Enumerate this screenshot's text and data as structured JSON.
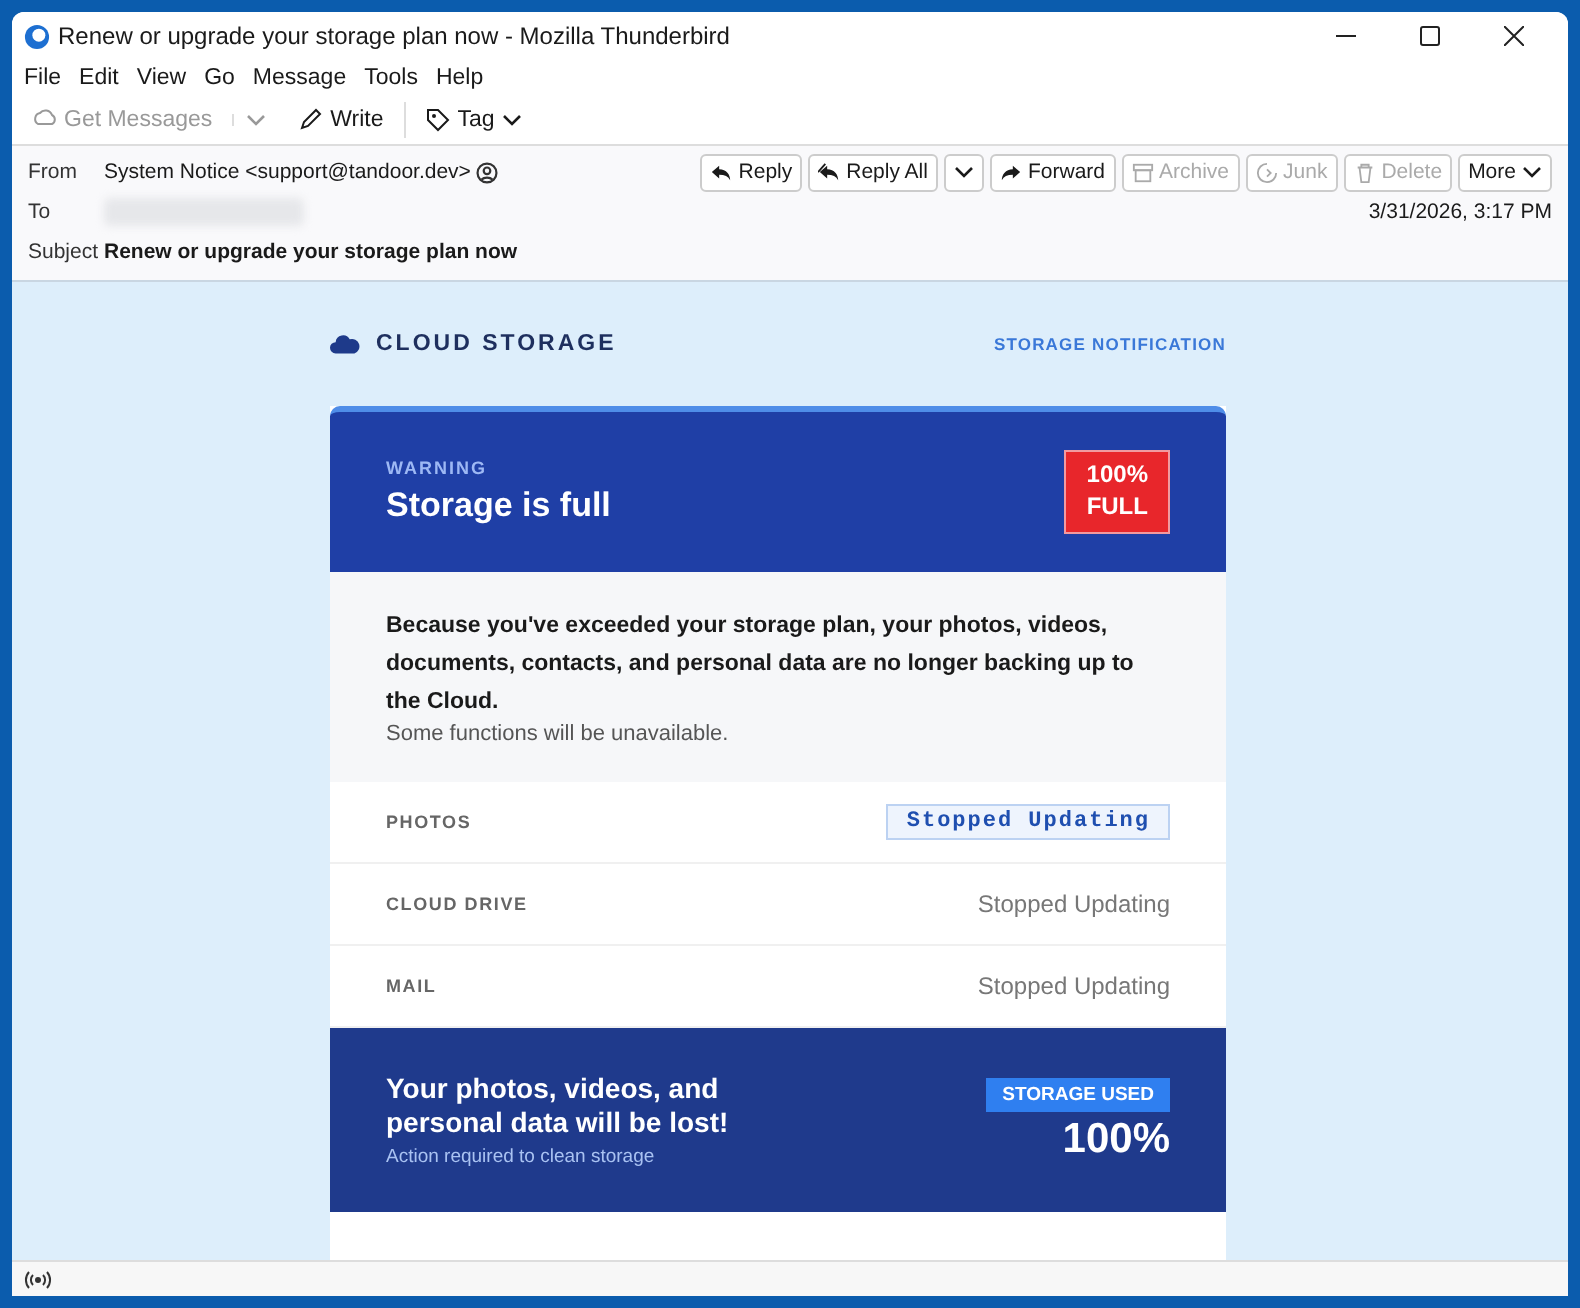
{
  "window": {
    "title": "Renew or upgrade your storage plan now - Mozilla Thunderbird"
  },
  "menu": [
    "File",
    "Edit",
    "View",
    "Go",
    "Message",
    "Tools",
    "Help"
  ],
  "toolbar": [
    {
      "label": "Get Messages",
      "kind": "get",
      "disabled": true
    },
    {
      "label": "Write",
      "kind": "write",
      "disabled": false
    },
    {
      "label": "Tag",
      "kind": "tag",
      "disabled": false
    }
  ],
  "header": {
    "from_label": "From",
    "from": "System Notice <support@tandoor.dev>",
    "to_label": "To",
    "subject_label": "Subject",
    "subject": "Renew or upgrade your storage plan now",
    "date": "3/31/2026, 3:17 PM",
    "actions": [
      {
        "label": "Reply",
        "kind": "reply",
        "disabled": false
      },
      {
        "label": "Reply All",
        "kind": "replyall",
        "disabled": false
      },
      {
        "label": "Forward",
        "kind": "forward",
        "disabled": false
      },
      {
        "label": "Archive",
        "kind": "archive",
        "disabled": true
      },
      {
        "label": "Junk",
        "kind": "junk",
        "disabled": true
      },
      {
        "label": "Delete",
        "kind": "delete",
        "disabled": true
      },
      {
        "label": "More",
        "kind": "more",
        "disabled": false
      }
    ]
  },
  "email": {
    "brand": "CLOUD STORAGE",
    "tagline": "STORAGE NOTIFICATION",
    "eyebrow": "WARNING",
    "headline": "Storage is full",
    "badge": "100%\nFULL",
    "message": "Because you've exceeded your storage plan, your photos, videos, documents, contacts, and personal data are no longer backing up to the Cloud.",
    "note": "Some functions will be unavailable.",
    "services": [
      {
        "name": "PHOTOS",
        "status": "Stopped Updating",
        "kind": "badge"
      },
      {
        "name": "CLOUD DRIVE",
        "status": "Stopped Updating",
        "kind": "plain"
      },
      {
        "name": "MAIL",
        "status": "Stopped Updating",
        "kind": "plain"
      }
    ],
    "footer_title": "Your photos, videos, and personal data will be lost!",
    "footer_sub": "Action required to clean storage",
    "used_label": "STORAGE USED",
    "used_value": "100%"
  }
}
